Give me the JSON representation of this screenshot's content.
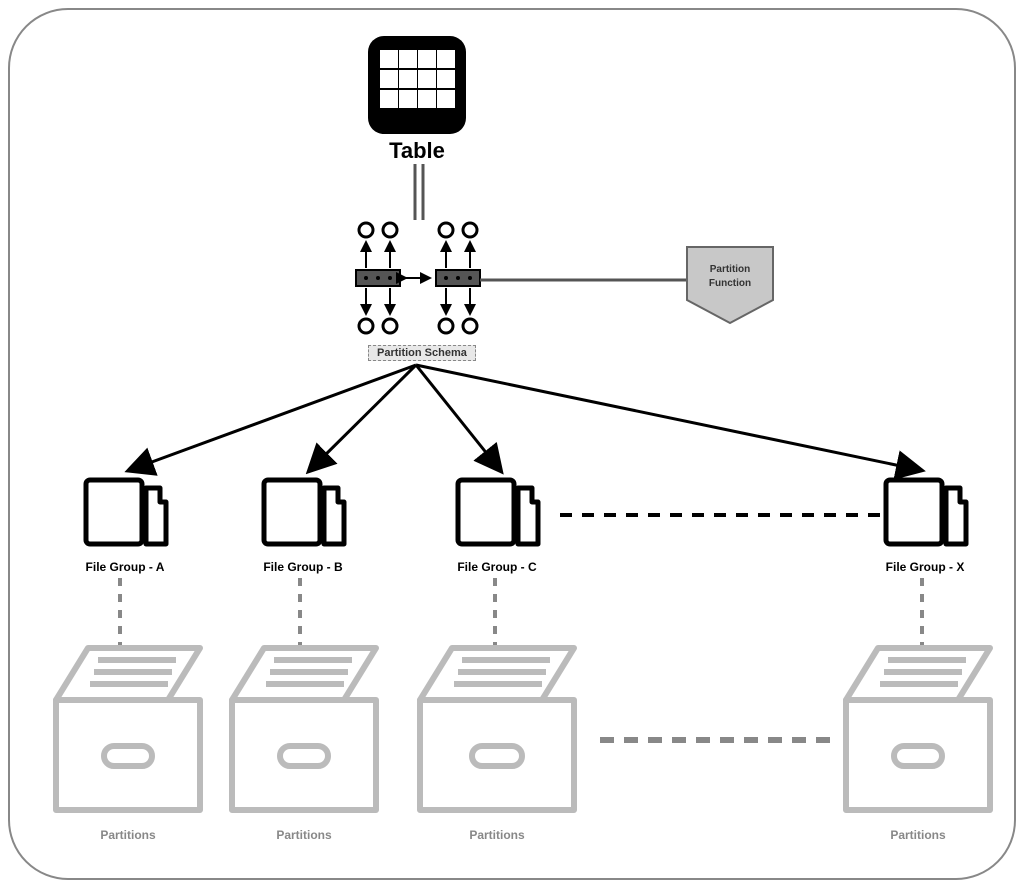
{
  "table_label": "Table",
  "schema_label": "Partition Schema",
  "partition_function_top": "Partition",
  "partition_function_bottom": "Function",
  "file_groups": [
    "File Group - A",
    "File Group - B",
    "File Group - C",
    "File Group - X"
  ],
  "partition_label": "Partitions"
}
